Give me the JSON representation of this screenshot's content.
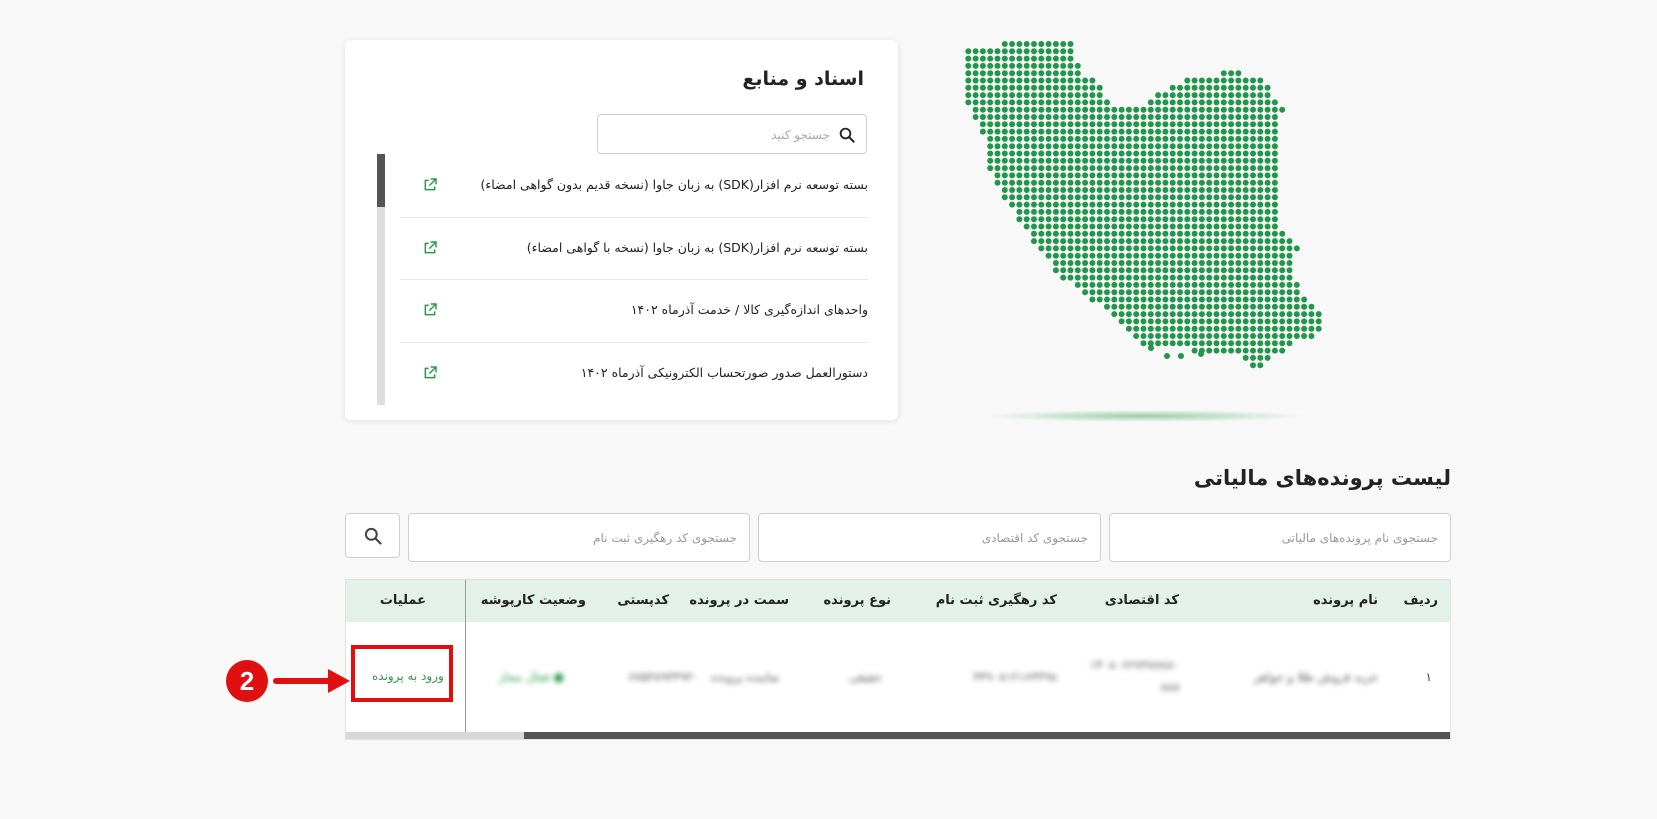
{
  "docs": {
    "title": "اسناد و منابع",
    "search_placeholder": "جستجو کنید",
    "items": [
      {
        "label": "بسته توسعه نرم افزار(SDK) به زبان جاوا (نسخه قدیم بدون گواهی امضاء)"
      },
      {
        "label": "بسته توسعه نرم افزار(SDK) به زبان جاوا (نسخه با گواهی امضاء)"
      },
      {
        "label": "واحدهای اندازه‌گیری کالا / خدمت آذرماه ۱۴۰۲"
      },
      {
        "label": "دستورالعمل صدور صورتحساب الکترونیکی آذرماه ۱۴۰۲"
      }
    ]
  },
  "tax_files": {
    "title": "لیست پرونده‌های مالیاتی",
    "filters": {
      "name_placeholder": "جستجوی نام پرونده‌های مالیاتی",
      "econ_placeholder": "جستجوی کد اقتصادی",
      "tracking_placeholder": "جستجوی کد رهگیری ثبت نام"
    },
    "columns": {
      "row": "ردیف",
      "name": "نام پرونده",
      "econ_code": "کد اقتصادی",
      "tracking_code": "کد رهگیری ثبت نام",
      "type": "نوع پرونده",
      "role": "سمت در پرونده",
      "postal": "کدپستی",
      "status": "وضعیت کارپوشه",
      "ops": "عملیات"
    },
    "rows": [
      {
        "row": "۱",
        "name": "خرید فروش طلا و جواهر",
        "econ_code": "۱۴۰۸۰۶۲۷۳۸۷۸۸۰",
        "econ_code_2": "۸۸۸",
        "tracking_code": "۳۴۹۰۸۱۲۱۶۳۳۹۸",
        "type": "حقیقی",
        "role": "نماینده پرونده",
        "postal": "۶۷۵۳۸۹۳۴۹۳۰",
        "status": "● فعال مجاز",
        "action": "ورود به پرونده"
      }
    ]
  },
  "annotation": {
    "step": "2",
    "color": "#e01010"
  },
  "colors": {
    "accent_green": "#2a9a4a",
    "map_dot": "#22964a",
    "header_bg": "#e4f1e8"
  },
  "icons": [
    "search-icon",
    "external-link-icon"
  ]
}
